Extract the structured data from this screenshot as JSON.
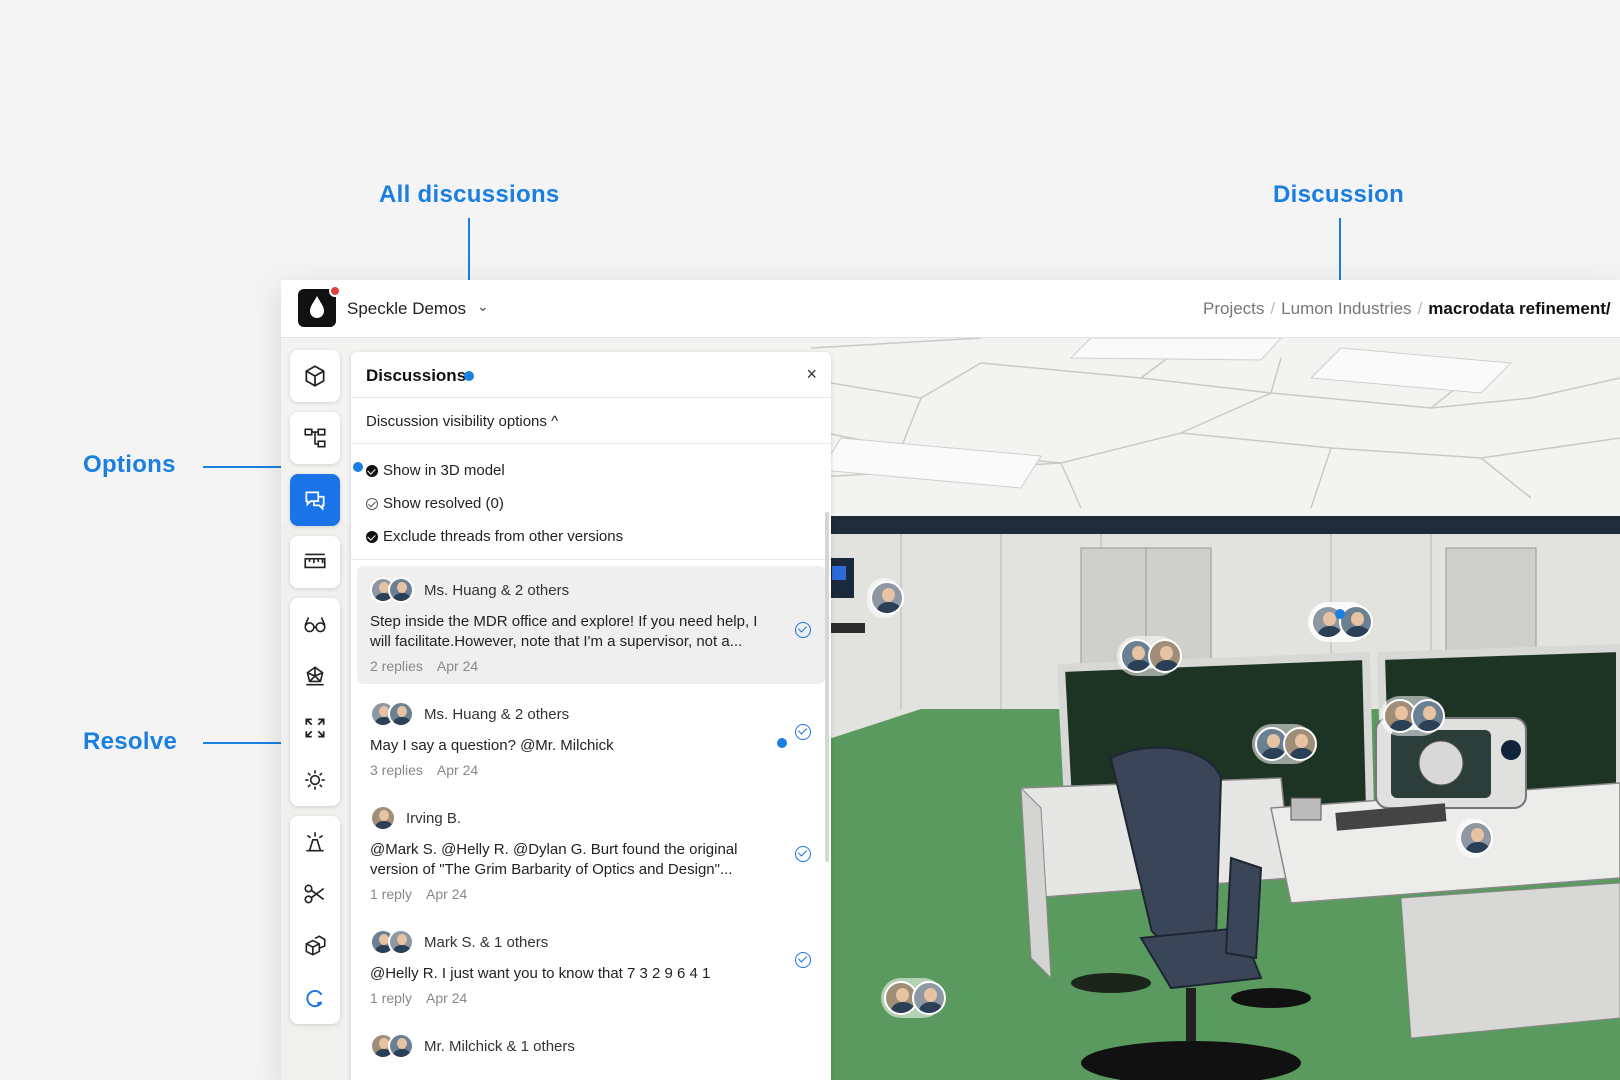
{
  "callouts": {
    "all_discussions": "All discussions",
    "discussion": "Discussion",
    "options": "Options",
    "resolve": "Resolve"
  },
  "topbar": {
    "workspace": "Speckle Demos",
    "breadcrumbs": [
      "Projects",
      "Lumon Industries",
      "macrodata refinement/"
    ]
  },
  "panel": {
    "title": "Discussions",
    "close": "×",
    "visibility_toggle": "Discussion visibility options ^",
    "options": [
      {
        "label": "Show in 3D model",
        "checked": true
      },
      {
        "label": "Show resolved (0)",
        "checked": false
      },
      {
        "label": "Exclude threads from other versions",
        "checked": true
      }
    ],
    "threads": [
      {
        "authors": "Ms. Huang & 2 others",
        "body": "Step inside the MDR office and explore! If you need help, I will facilitate.However, note that I'm a supervisor, not a...",
        "replies": "2 replies",
        "date": "Apr 24"
      },
      {
        "authors": "Ms. Huang & 2 others",
        "body": "May I say a question? @Mr. Milchick",
        "replies": "3 replies",
        "date": "Apr 24"
      },
      {
        "authors": "Irving B.",
        "body": "@Mark S. @Helly R. @Dylan G. Burt found the original version of \"The Grim Barbarity of Optics and Design\"...",
        "replies": "1 reply",
        "date": "Apr 24"
      },
      {
        "authors": "Mark S. & 1 others",
        "body": "@Helly R. I just want you to know that 7 3 2 9 6 4 1",
        "replies": "1 reply",
        "date": "Apr 24"
      },
      {
        "authors": "Mr. Milchick & 1 others",
        "body": "",
        "replies": "",
        "date": ""
      }
    ]
  },
  "colors": {
    "accent": "#1a7fe0",
    "active_tool": "#1a73e8",
    "notification": "#e0413f"
  }
}
